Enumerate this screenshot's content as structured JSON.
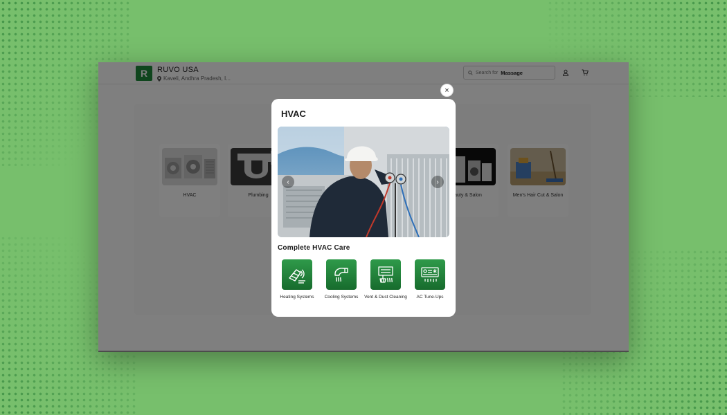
{
  "header": {
    "brand": "RUVO USA",
    "logo_letter": "R",
    "location": "Kaveli, Andhra Pradesh, I...",
    "search_prefix": "Search for",
    "search_term": "Massage"
  },
  "categories": [
    {
      "label": "HVAC"
    },
    {
      "label": "Plumbing"
    },
    {
      "label": "auty & Salon"
    },
    {
      "label": "Men's Hair Cut & Salon"
    }
  ],
  "modal": {
    "title": "HVAC",
    "close_glyph": "×",
    "prev_glyph": "‹",
    "next_glyph": "›",
    "section_title": "Complete HVAC Care",
    "services": [
      {
        "label": "Heating Systems",
        "icon": "heating-icon"
      },
      {
        "label": "Cooling Systems",
        "icon": "cooling-icon"
      },
      {
        "label": "Vent & Dust Cleaning",
        "icon": "vent-cleaning-icon"
      },
      {
        "label": "AC Tune-Ups",
        "icon": "ac-unit-icon"
      }
    ]
  },
  "colors": {
    "background": "#77bf6c",
    "brand_green": "#1f8a3a",
    "icon_green_top": "#2f9a4a",
    "icon_green_bottom": "#176b2d"
  }
}
